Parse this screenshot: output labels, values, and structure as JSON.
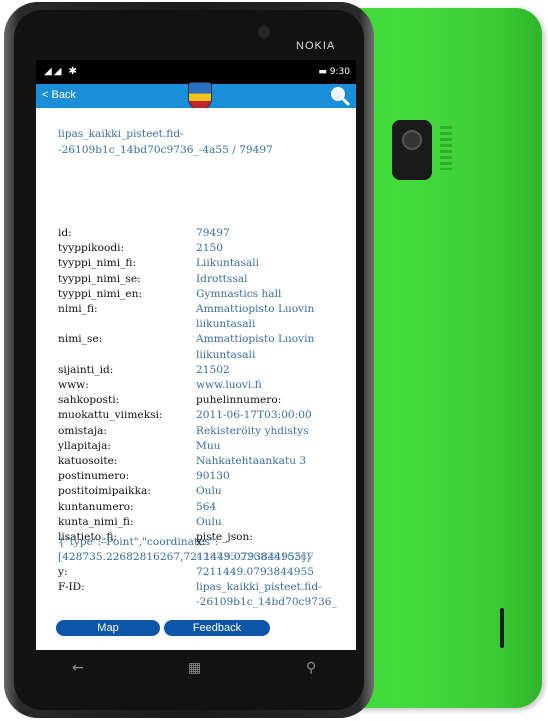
{
  "device": {
    "brand": "NOKIA"
  },
  "status": {
    "signal": "◢◢ ✱",
    "battery": "▬ 9:30"
  },
  "nav": {
    "back_label": "< Back"
  },
  "record": {
    "heading_line1": "lipas_kaikki_pisteet.fid-",
    "heading_line2": "-26109b1c_14bd70c9736_-4a55 / 79497",
    "fields": [
      {
        "key": "id:",
        "value": "79497"
      },
      {
        "key": "tyyppikoodi:",
        "value": "2150"
      },
      {
        "key": "tyyppi_nimi_fi:",
        "value": "Liikuntasali"
      },
      {
        "key": "tyyppi_nimi_se:",
        "value": "Idrottssal"
      },
      {
        "key": "tyyppi_nimi_en:",
        "value": "Gymnastics hall"
      },
      {
        "key": "nimi_fi:",
        "value": "Ammattiopisto Luovin",
        "value2": "liikuntasali"
      },
      {
        "key": "nimi_se:",
        "value": "Ammattiopisto Luovin",
        "value2": "liikuntasali"
      },
      {
        "key": "sijainti_id:",
        "value": "21502"
      },
      {
        "key": "www:",
        "value": "www.luovi.fi"
      },
      {
        "key": "sahkoposti:",
        "value": "puhelinnumero:"
      },
      {
        "key": "muokattu_viimeksi:",
        "value": "2011-06-17T03:00:00"
      },
      {
        "key": "omistaja:",
        "value": "Rekisteröity yhdistys"
      },
      {
        "key": "yllapitaja:",
        "value": "Muu"
      },
      {
        "key": "katuosoite:",
        "value": "Nahkatehtaankatu 3"
      },
      {
        "key": "postinumero:",
        "value": "90130"
      },
      {
        "key": "postitoimipaikka:",
        "value": "Oulu"
      },
      {
        "key": "kuntanumero:",
        "value": "564"
      },
      {
        "key": "kunta_nimi_fi:",
        "value": "Oulu"
      },
      {
        "key": "lisatieto_fi:",
        "value": "piste_json:"
      }
    ],
    "json_line1": "{\"type\":\"Point\",\"coordinates\":",
    "json_line2": "[428735.22682816267,7211449.0793844955]}",
    "x_key": "x:",
    "x_value": "428735.22682816267",
    "y_key": "y:",
    "y_value": "7211449.0793844955",
    "fid_key": "F-ID:",
    "fid_value1": "lipas_kaikki_pisteet.fid-",
    "fid_value2": "-26109b1c_14bd70c9736_"
  },
  "buttons": {
    "map": "Map",
    "feedback": "Feedback"
  },
  "colors": {
    "accent": "#1b8ed8",
    "link": "#3b6d9e",
    "button": "#0c55a8",
    "phone_back": "#44dd3c"
  }
}
